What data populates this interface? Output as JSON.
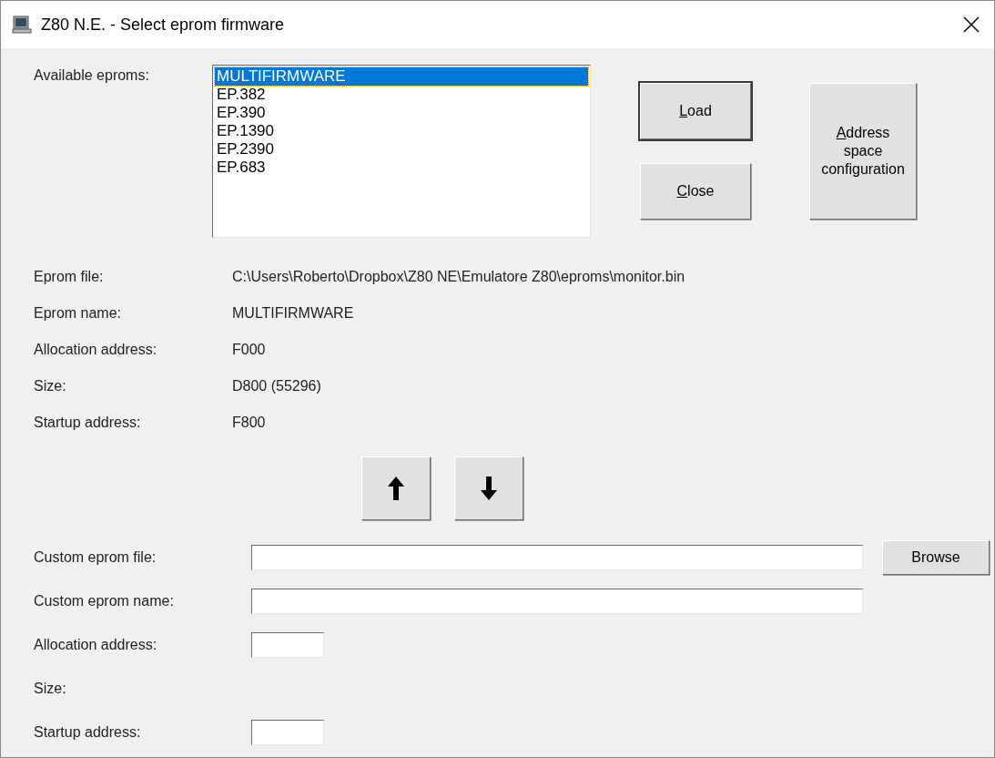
{
  "window": {
    "title": "Z80 N.E. - Select eprom firmware"
  },
  "available": {
    "label": "Available eproms:",
    "items": [
      {
        "label": "MULTIFIRMWARE",
        "selected": true
      },
      {
        "label": "EP.382",
        "selected": false
      },
      {
        "label": "EP.390",
        "selected": false
      },
      {
        "label": "EP.1390",
        "selected": false
      },
      {
        "label": "EP.2390",
        "selected": false
      },
      {
        "label": "EP.683",
        "selected": false
      }
    ]
  },
  "buttons": [
    {
      "label": "Load",
      "underline_first": true,
      "focused": true
    },
    {
      "label": "Close",
      "underline_first": true,
      "focused": false
    }
  ],
  "config_button": {
    "label": "Address space configuration",
    "underline_first": true
  },
  "info": [
    {
      "label": "Eprom file:",
      "value": "C:\\Users\\Roberto\\Dropbox\\Z80 NE\\Emulatore Z80\\eproms\\monitor.bin"
    },
    {
      "label": "Eprom name:",
      "value": "MULTIFIRMWARE"
    },
    {
      "label": "Allocation address:",
      "value": "F000"
    },
    {
      "label": "Size:",
      "value": "D800 (55296)"
    },
    {
      "label": "Startup address:",
      "value": "F800"
    }
  ],
  "move_buttons": [
    {
      "kind": "up"
    },
    {
      "kind": "down"
    }
  ],
  "custom": [
    {
      "label": "Custom eprom file:",
      "kind": "wide",
      "browse": "Browse"
    },
    {
      "label": "Custom eprom name:",
      "kind": "wide"
    },
    {
      "label": "Allocation address:",
      "kind": "short"
    },
    {
      "label": "Size:",
      "kind": "none"
    },
    {
      "label": "Startup address:",
      "kind": "short"
    }
  ]
}
